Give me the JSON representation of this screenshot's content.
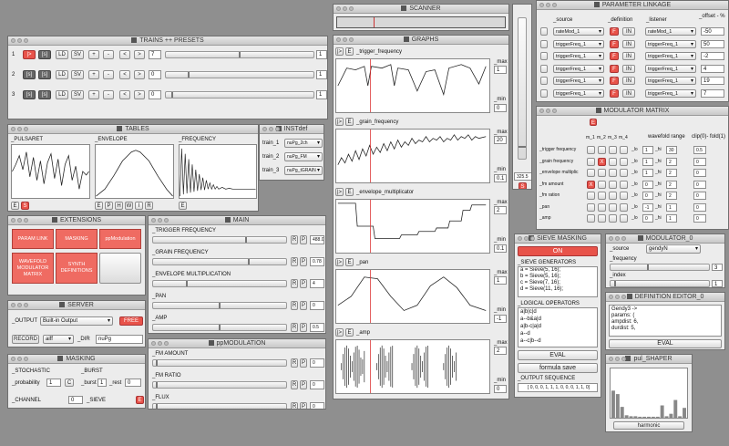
{
  "windows": {
    "trains": "TRAINS ++ PRESETS",
    "tables": "TABLES",
    "inst": "INSTdef",
    "extensions": "EXTENSIONS",
    "server": "SERVER",
    "masking": "MASKING",
    "main": "MAIN",
    "ppmod": "ppMODULATION",
    "scanner": "SCANNER",
    "graphs": "GRAPHS",
    "paramlink": "PARAMETER LINKAGE",
    "modmatrix": "MODULATOR MATRIX",
    "sieve": "SIEVE MASKING",
    "modulator": "MODULATOR_0",
    "defeditor": "DEFINITION EDITOR_0",
    "shaper": "pul_SHAPER"
  },
  "trains": {
    "rows": [
      {
        "num": "1",
        "play": "|>",
        "stop": "[s]",
        "ld": "LD",
        "sv": "SV",
        "plus": "+",
        "minus": "-",
        "prev": "<",
        "next": ">",
        "preset": "7",
        "val": "1"
      },
      {
        "num": "2",
        "play": "[s]",
        "stop": "[s]",
        "ld": "LD",
        "sv": "SV",
        "plus": "+",
        "minus": "-",
        "prev": "<",
        "next": ">",
        "preset": "0",
        "val": "1"
      },
      {
        "num": "3",
        "play": "[s]",
        "stop": "[s]",
        "ld": "LD",
        "sv": "SV",
        "plus": "+",
        "minus": "-",
        "prev": "<",
        "next": ">",
        "preset": "0",
        "val": "1"
      }
    ]
  },
  "tables": {
    "labels": [
      "_PULSARET",
      "_ENVELOPE",
      "_FREQUENCY"
    ],
    "pulsaret_buttons": [
      "E",
      "S"
    ],
    "envelope_buttons": [
      "E",
      "P",
      "H",
      "W",
      "I",
      "R"
    ],
    "frequency_buttons": [
      "E"
    ]
  },
  "inst": {
    "rows": [
      {
        "label": "train_1",
        "value": "nuPg_2ch"
      },
      {
        "label": "train_2",
        "value": "nuPg_FM"
      },
      {
        "label": "train_3",
        "value": "nuPg_tGRAIN"
      }
    ]
  },
  "extensions": {
    "buttons": [
      "PARAM LINK",
      "MASKING",
      "ppModulation",
      "WAVEFOLD\nMODULATOR\nMATRIX",
      "SYNTH\nDEFINITIONS",
      ""
    ]
  },
  "server": {
    "output_label": "_OUTPUT",
    "output_value": "Built-in Output",
    "free": "FREE",
    "record": "RECORD",
    "format": "aiff",
    "dir_label": "_DIR",
    "dir_value": "nuPg"
  },
  "masking": {
    "stochastic": "_STOCHASTIC",
    "burst": "_BURST",
    "probability_label": "_probability",
    "probability_value": "1",
    "c_btn": "C",
    "burst_label": "_burst",
    "burst_value": "1",
    "rest_label": "_rest",
    "rest_value": "0",
    "channel_label": "_CHANNEL",
    "channel_value": "0",
    "sieve_label": "_SIEVE",
    "e_btn": "E"
  },
  "main": {
    "rows": [
      {
        "label": "_TRIGGER FREQUENCY",
        "value": "488.0",
        "level": 0.7
      },
      {
        "label": "_GRAIN FREQUENCY",
        "value": "0.78",
        "level": 0.72
      },
      {
        "label": "_ENVELOPE MULTIPLICATION",
        "value": "4",
        "level": 0.25
      },
      {
        "label": "_PAN",
        "value": "0",
        "level": 0.5
      },
      {
        "label": "_AMP",
        "value": "0.5",
        "level": 0.5
      }
    ],
    "r": "R",
    "p": "P"
  },
  "ppmod": {
    "rows": [
      {
        "label": "_FM AMOUNT",
        "value": "0",
        "level": 0.02
      },
      {
        "label": "_FM RATIO",
        "value": "0",
        "level": 0.02
      },
      {
        "label": "_FLUX",
        "value": "0",
        "level": 0.02
      }
    ],
    "r": "R",
    "p": "P"
  },
  "scanner": {
    "value": "325.5",
    "s": "S"
  },
  "graphs": {
    "rows": [
      {
        "label": "_trigger_frequency",
        "max_label": "_max",
        "max": "1",
        "min_label": "_min",
        "min": "0"
      },
      {
        "label": "_grain_frequency",
        "max_label": "_max",
        "max": "20",
        "min_label": "_min",
        "min": "0.1"
      },
      {
        "label": "_envelope_multiplicator",
        "max_label": "_max",
        "max": "2",
        "min_label": "_min",
        "min": "0.1"
      },
      {
        "label": "_pan",
        "max_label": "_max",
        "max": "1",
        "min_label": "_min",
        "min": "-1"
      },
      {
        "label": "_amp",
        "max_label": "_max",
        "max": "2",
        "min_label": "_min",
        "min": "0"
      }
    ],
    "play": "|>",
    "e": "E"
  },
  "paramlink": {
    "headers": {
      "source": "_source",
      "definition": "_definition",
      "listener": "_listener",
      "offset": "_offset - %"
    },
    "rows": [
      {
        "source": "rateMod_1",
        "listener": "rateMod_1",
        "offset": "-50"
      },
      {
        "source": "triggerFreq_1",
        "listener": "triggerFreq_1",
        "offset": "50"
      },
      {
        "source": "triggerFreq_1",
        "listener": "triggerFreq_1",
        "offset": "-2"
      },
      {
        "source": "triggerFreq_1",
        "listener": "triggerFreq_1",
        "offset": "4"
      },
      {
        "source": "triggerFreq_1",
        "listener": "triggerFreq_1",
        "offset": "19"
      },
      {
        "source": "triggerFreq_1",
        "listener": "triggerFreq_1",
        "offset": "7"
      }
    ],
    "f": "F",
    "in": "IN"
  },
  "modmatrix": {
    "e": "E",
    "heads": [
      "m_1",
      "m_2",
      "m_3",
      "m_4"
    ],
    "wavefold": "wavefold range",
    "clip": "clip(0)- fold(1)",
    "rows": [
      {
        "label": "_trigger frequency",
        "x": [
          false,
          false,
          false,
          false
        ],
        "lo": "1",
        "hi": "30",
        "clip": "0.5"
      },
      {
        "label": "_grain frequency",
        "x": [
          false,
          true,
          false,
          false
        ],
        "lo": "1",
        "hi": "2",
        "clip": "0"
      },
      {
        "label": "_envelope multiplic",
        "x": [
          false,
          false,
          false,
          false
        ],
        "lo": "1",
        "hi": "2",
        "clip": "0"
      },
      {
        "label": "_fm amount",
        "x": [
          true,
          false,
          false,
          false
        ],
        "lo": "0",
        "hi": "2",
        "clip": "0"
      },
      {
        "label": "_fm ration",
        "x": [
          false,
          false,
          false,
          false
        ],
        "lo": "0",
        "hi": "2",
        "clip": "0"
      },
      {
        "label": "_pan",
        "x": [
          false,
          false,
          false,
          false
        ],
        "lo": "-1",
        "hi": "1",
        "clip": "0"
      },
      {
        "label": "_amp",
        "x": [
          false,
          false,
          false,
          false
        ],
        "lo": "0",
        "hi": "1",
        "clip": "0"
      }
    ],
    "lo_label": "_lo",
    "hi_label": "_hi"
  },
  "sieve": {
    "on": "ON",
    "gen_label": "_SIEVE GENERATORS",
    "generators": [
      "a = Sieve(5, 16);",
      "b = Sieve(5, 16);",
      "c = Sieve(7, 16);",
      "d = Sieve(11, 16);"
    ],
    "ops_label": "_LOGICAL OPERATORS",
    "ops": [
      "a|b|c|d",
      "a--b&a|d",
      "a|b-c|a|d",
      "a--d",
      "a--c|b--d"
    ],
    "eval": "EVAL",
    "save": "formula save",
    "seq_label": "_OUTPUT SEQUENCE",
    "seq": "[ 0, 0, 0, 1, 1, 1, 0, 0, 0, 1, 1, 0]"
  },
  "modulator": {
    "source_label": "_source",
    "source_value": "gendyN",
    "freq_label": "_frequency",
    "freq_value": "3",
    "index_label": "_index",
    "index_value": "1"
  },
  "defeditor": {
    "lines": [
      "Gendy3 ->",
      "params: (",
      "ampdist: 6,",
      "durdist: 5,"
    ],
    "eval": "EVAL"
  },
  "shaper": {
    "button": "harmonic",
    "bars": [
      0.55,
      0.48,
      0.22,
      0.05,
      0.03,
      0.03,
      0.02,
      0.02,
      0.02,
      0.02,
      0.02,
      0.25,
      0.03,
      0.08,
      0.36,
      0.03,
      0.2
    ]
  },
  "colors": {
    "accent": "#e8534a",
    "bg": "#8f8f8f",
    "panel": "#ececec"
  }
}
